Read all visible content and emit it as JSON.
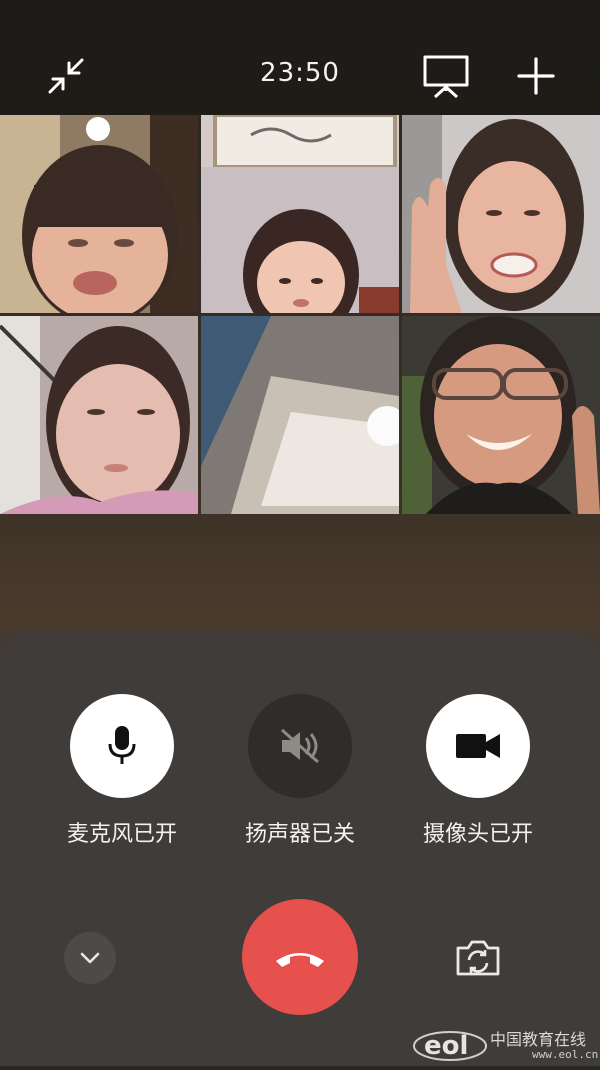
{
  "status": {
    "time": "23:50"
  },
  "controls": {
    "mic_label": "麦克风已开",
    "speaker_label": "扬声器已关",
    "camera_label": "摄像头已开"
  },
  "watermark": {
    "logo_text": "eol",
    "site_name": "中国教育在线",
    "url": "www.eol.cn"
  },
  "colors": {
    "hangup": "#e6504d",
    "control_on": "#ffffff",
    "control_off": "#2f2c2a"
  },
  "icons": {
    "minimize": "minimize-arrows-icon",
    "screen_share": "screen-share-icon",
    "add": "plus-icon",
    "mic": "microphone-icon",
    "speaker": "speaker-muted-icon",
    "camera": "video-camera-icon",
    "hangup": "phone-hangup-icon",
    "collapse": "chevron-down-icon",
    "flip": "camera-flip-icon"
  }
}
